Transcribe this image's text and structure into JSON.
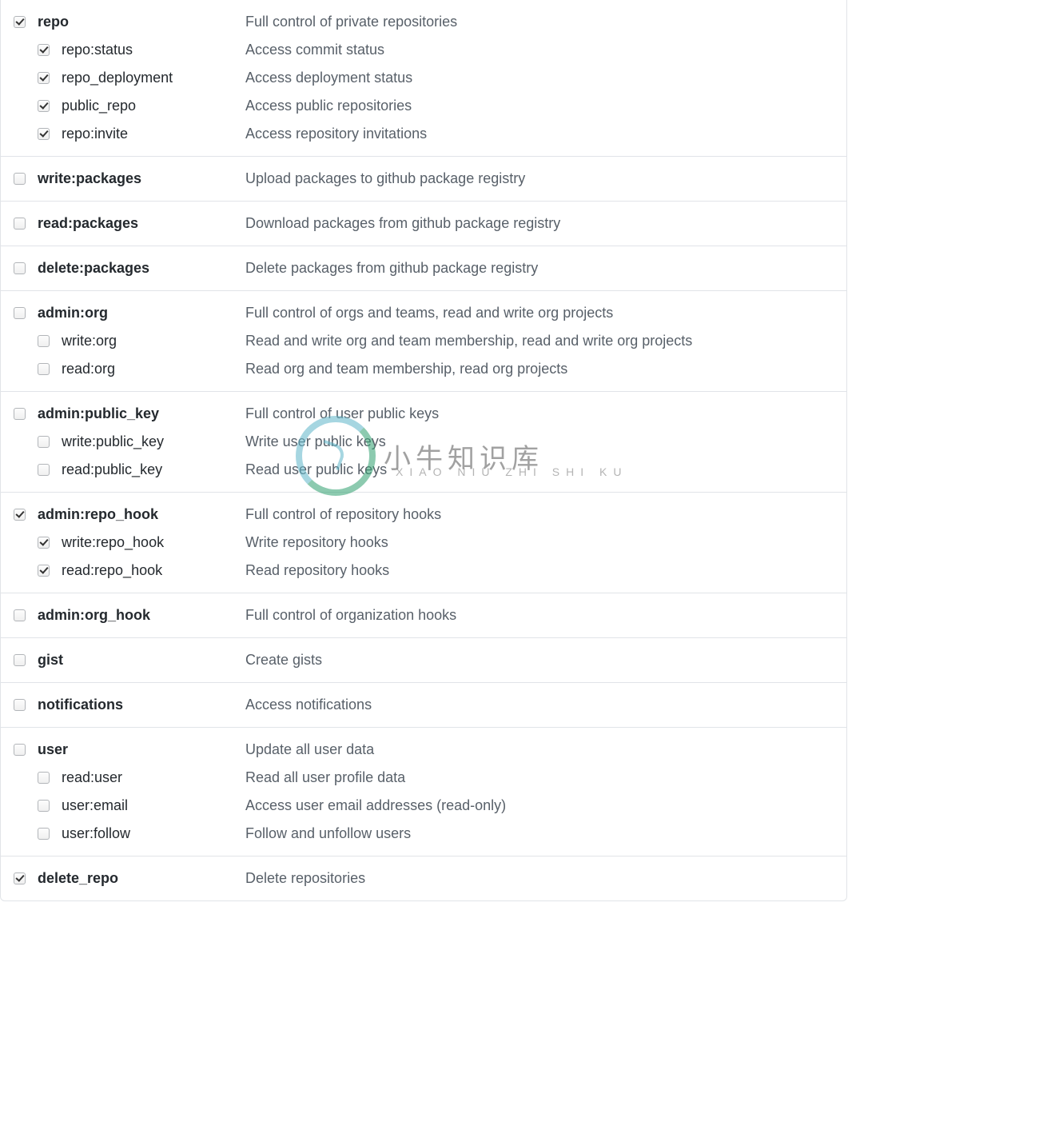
{
  "watermark": {
    "big": "小牛知识库",
    "small": "XIAO NIU ZHI SHI KU"
  },
  "groups": [
    {
      "name": "repo",
      "desc": "Full control of private repositories",
      "checked": true,
      "children": [
        {
          "name": "repo:status",
          "desc": "Access commit status",
          "checked": true
        },
        {
          "name": "repo_deployment",
          "desc": "Access deployment status",
          "checked": true
        },
        {
          "name": "public_repo",
          "desc": "Access public repositories",
          "checked": true
        },
        {
          "name": "repo:invite",
          "desc": "Access repository invitations",
          "checked": true
        }
      ]
    },
    {
      "name": "write:packages",
      "desc": "Upload packages to github package registry",
      "checked": false,
      "children": []
    },
    {
      "name": "read:packages",
      "desc": "Download packages from github package registry",
      "checked": false,
      "children": []
    },
    {
      "name": "delete:packages",
      "desc": "Delete packages from github package registry",
      "checked": false,
      "children": []
    },
    {
      "name": "admin:org",
      "desc": "Full control of orgs and teams, read and write org projects",
      "checked": false,
      "children": [
        {
          "name": "write:org",
          "desc": "Read and write org and team membership, read and write org projects",
          "checked": false
        },
        {
          "name": "read:org",
          "desc": "Read org and team membership, read org projects",
          "checked": false
        }
      ]
    },
    {
      "name": "admin:public_key",
      "desc": "Full control of user public keys",
      "checked": false,
      "children": [
        {
          "name": "write:public_key",
          "desc": "Write user public keys",
          "checked": false
        },
        {
          "name": "read:public_key",
          "desc": "Read user public keys",
          "checked": false
        }
      ]
    },
    {
      "name": "admin:repo_hook",
      "desc": "Full control of repository hooks",
      "checked": true,
      "children": [
        {
          "name": "write:repo_hook",
          "desc": "Write repository hooks",
          "checked": true
        },
        {
          "name": "read:repo_hook",
          "desc": "Read repository hooks",
          "checked": true
        }
      ]
    },
    {
      "name": "admin:org_hook",
      "desc": "Full control of organization hooks",
      "checked": false,
      "children": []
    },
    {
      "name": "gist",
      "desc": "Create gists",
      "checked": false,
      "children": []
    },
    {
      "name": "notifications",
      "desc": "Access notifications",
      "checked": false,
      "children": []
    },
    {
      "name": "user",
      "desc": "Update all user data",
      "checked": false,
      "children": [
        {
          "name": "read:user",
          "desc": "Read all user profile data",
          "checked": false
        },
        {
          "name": "user:email",
          "desc": "Access user email addresses (read-only)",
          "checked": false
        },
        {
          "name": "user:follow",
          "desc": "Follow and unfollow users",
          "checked": false
        }
      ]
    },
    {
      "name": "delete_repo",
      "desc": "Delete repositories",
      "checked": true,
      "children": []
    }
  ]
}
